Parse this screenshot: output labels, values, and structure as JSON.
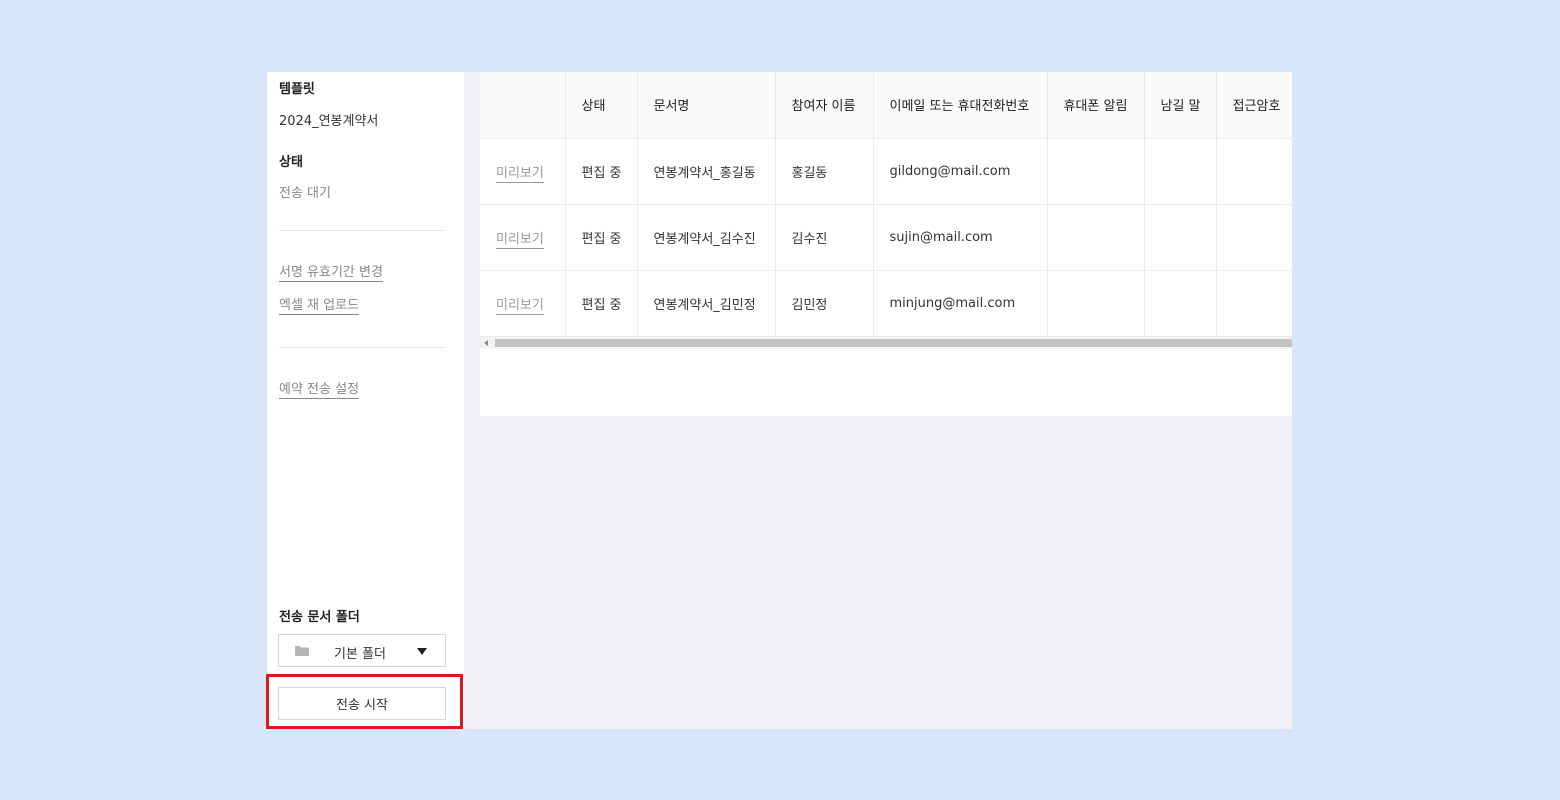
{
  "sidebar": {
    "template_title": "템플릿",
    "template_value": "2024_연봉계약서",
    "status_title": "상태",
    "status_value": "전송 대기",
    "links": {
      "change_validity": "서명 유효기간 변경",
      "excel_reupload": "엑셀 재 업로드",
      "schedule_send": "예약 전송 설정"
    },
    "folder_title": "전송 문서 폴더",
    "folder_selected": "기본 폴더",
    "start_button": "전송 시작"
  },
  "table": {
    "headers": [
      "",
      "상태",
      "문서명",
      "참여자 이름",
      "이메일 또는 휴대전화번호",
      "휴대폰 알림",
      "남길 말",
      "접근암호"
    ],
    "rows": [
      {
        "preview": "미리보기",
        "status": "편집 중",
        "doc_name": "연봉계약서_홍길동",
        "participant": "홍길동",
        "contact": "gildong@mail.com",
        "sms_alert": "",
        "message": "",
        "password": ""
      },
      {
        "preview": "미리보기",
        "status": "편집 중",
        "doc_name": "연봉계약서_김수진",
        "participant": "김수진",
        "contact": "sujin@mail.com",
        "sms_alert": "",
        "message": "",
        "password": ""
      },
      {
        "preview": "미리보기",
        "status": "편집 중",
        "doc_name": "연봉계약서_김민정",
        "participant": "김민정",
        "contact": "minjung@mail.com",
        "sms_alert": "",
        "message": "",
        "password": ""
      }
    ]
  },
  "icons": {
    "folder": "folder-icon",
    "dropdown": "chevron-down-icon",
    "scroll_left": "arrow-left-icon"
  },
  "colors": {
    "highlight_border": "#e0161c",
    "page_background": "#d8e6fc"
  }
}
